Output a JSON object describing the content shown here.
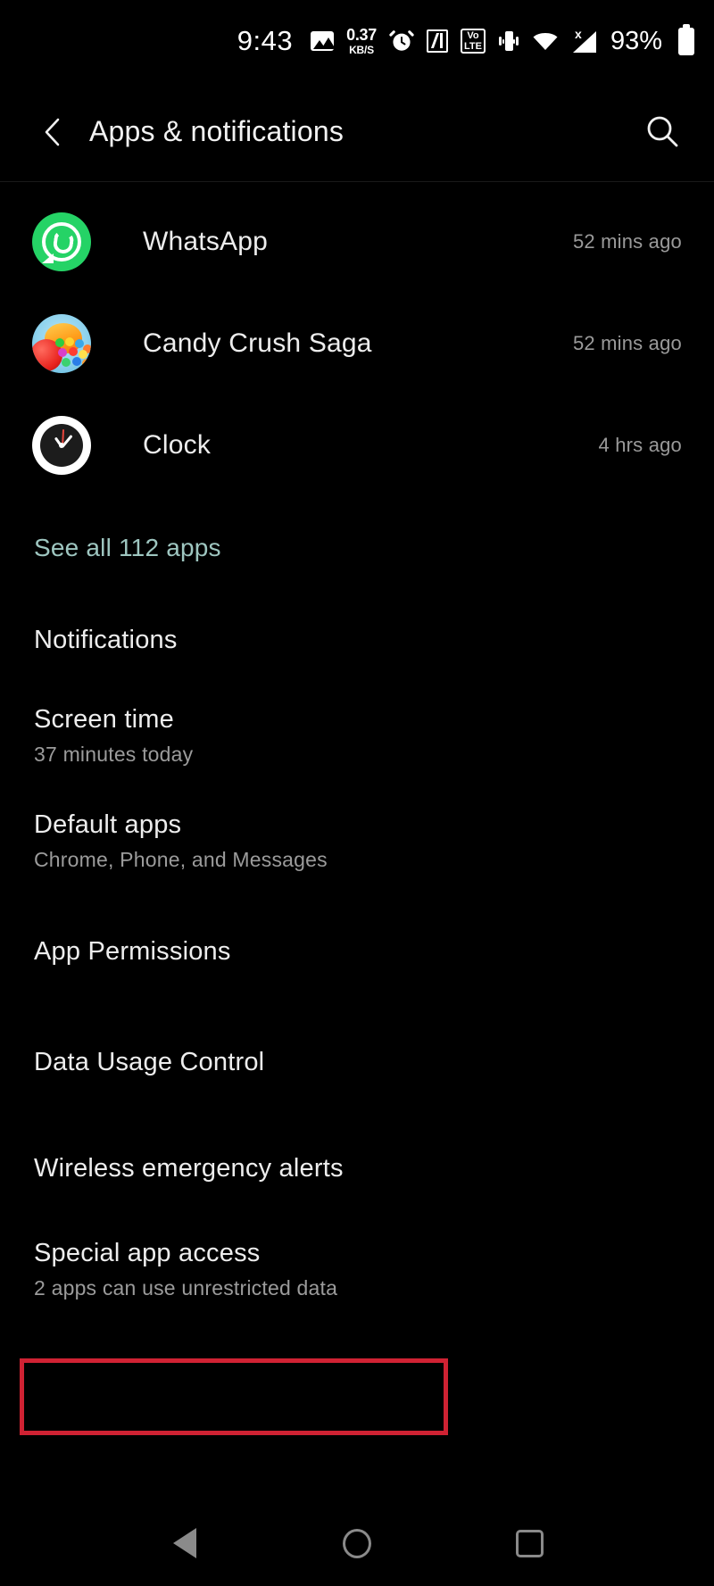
{
  "status_bar": {
    "time": "9:43",
    "data_speed_value": "0.37",
    "data_speed_unit": "KB/S",
    "volte_top": "Vo",
    "volte_bottom": "LTE",
    "signal_marker": "x",
    "battery_percent": "93%",
    "icons": [
      "image-icon",
      "data-speed-icon",
      "alarm-icon",
      "nfc-icon",
      "volte-icon",
      "vibrate-icon",
      "wifi-icon",
      "cellular-signal-icon",
      "battery-icon"
    ]
  },
  "header": {
    "back_label": "back-chevron",
    "title": "Apps & notifications",
    "search_label": "search-icon"
  },
  "recent_apps": [
    {
      "name": "WhatsApp",
      "time": "52 mins ago",
      "icon": "whatsapp-icon"
    },
    {
      "name": "Candy Crush Saga",
      "time": "52 mins ago",
      "icon": "candy-crush-icon"
    },
    {
      "name": "Clock",
      "time": "4 hrs ago",
      "icon": "clock-icon"
    }
  ],
  "see_all": {
    "label": "See all 112 apps",
    "app_count": "112",
    "color": "#9ec6c0"
  },
  "settings_items": [
    {
      "title": "Notifications",
      "subtitle": ""
    },
    {
      "title": "Screen time",
      "subtitle": "37 minutes today"
    },
    {
      "title": "Default apps",
      "subtitle": "Chrome, Phone, and Messages"
    },
    {
      "title": "App Permissions",
      "subtitle": ""
    },
    {
      "title": "Data Usage Control",
      "subtitle": ""
    },
    {
      "title": "Wireless emergency alerts",
      "subtitle": ""
    },
    {
      "title": "Special app access",
      "subtitle": "2 apps can use unrestricted data"
    }
  ],
  "annotation": {
    "target": "Special app access",
    "color": "#cf2233"
  },
  "nav_bar": {
    "back": "back-triangle-icon",
    "home": "home-circle-icon",
    "recents": "recents-square-icon"
  },
  "theme": {
    "background": "#000000",
    "primary_text": "#ededed",
    "secondary_text": "#9b9b9b",
    "accent": "#9ec6c0"
  }
}
